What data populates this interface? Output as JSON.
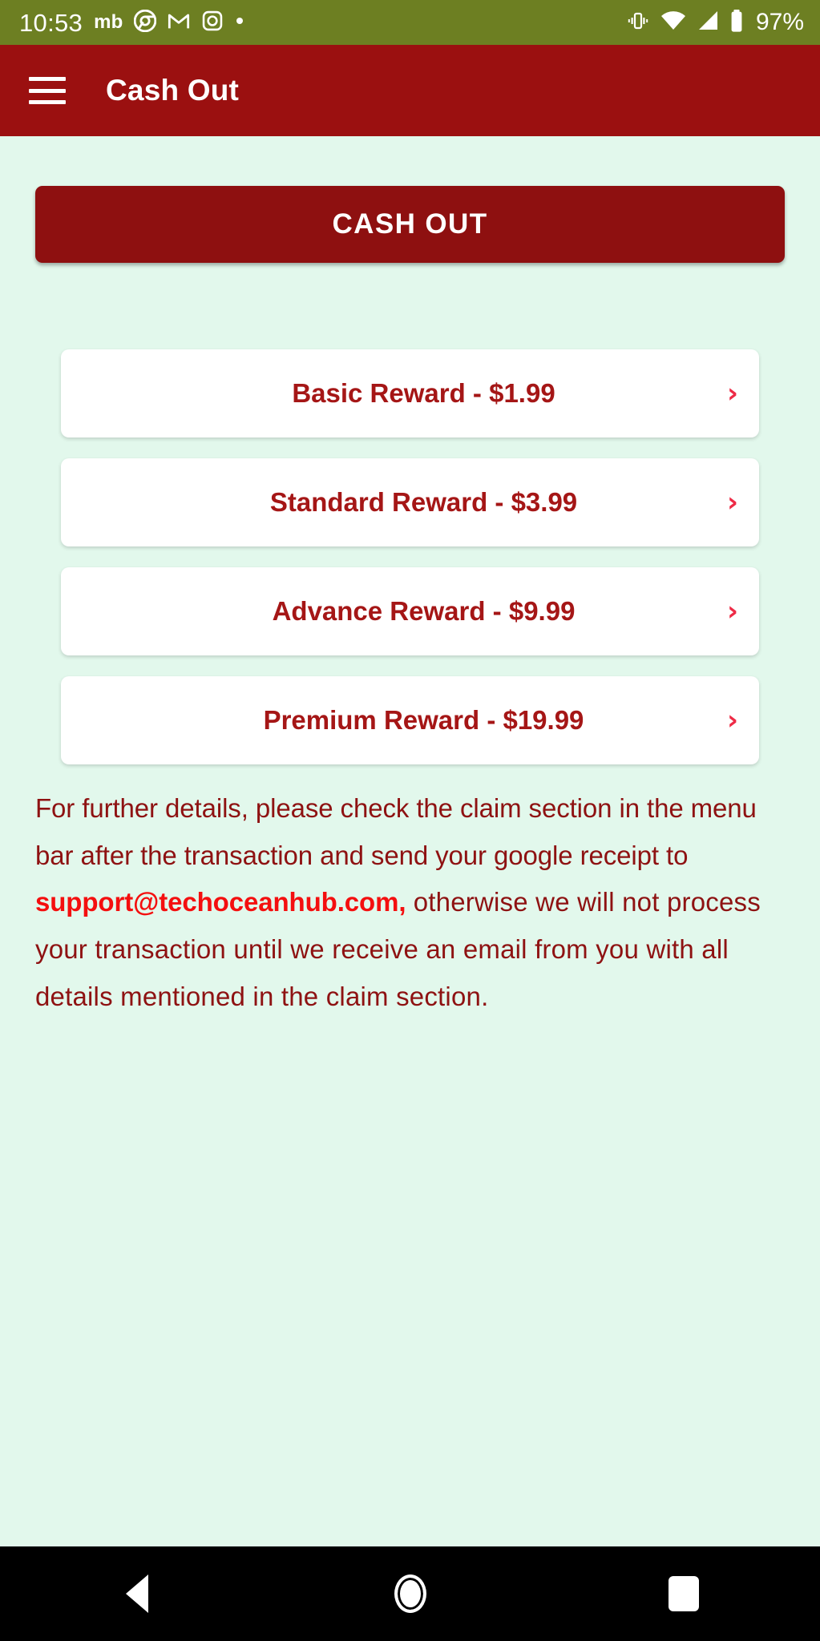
{
  "status_bar": {
    "time": "10:53",
    "mb_label": "mb",
    "battery_percent": "97%",
    "left_icons": [
      "chrome-icon",
      "gmail-icon",
      "instagram-icon",
      "dot-icon"
    ],
    "right_icons": [
      "vibrate-icon",
      "wifi-icon",
      "cellular-signal-icon",
      "battery-icon"
    ],
    "background_color": "#6D7F22"
  },
  "app_bar": {
    "menu_icon": "hamburger-menu-icon",
    "title": "Cash Out",
    "background_color": "#9B1010"
  },
  "main": {
    "background_color": "#E2F8EC",
    "cash_out_button": {
      "label": "CASH OUT",
      "background_color": "#8E1010",
      "text_color": "#FFFFFF"
    },
    "rewards": [
      {
        "label": "Basic Reward - $1.99",
        "price": "$1.99",
        "tier": "Basic",
        "chevron": "chevron-right-icon"
      },
      {
        "label": "Standard Reward - $3.99",
        "price": "$3.99",
        "tier": "Standard",
        "chevron": "chevron-right-icon"
      },
      {
        "label": "Advance Reward - $9.99",
        "price": "$9.99",
        "tier": "Advance",
        "chevron": "chevron-right-icon"
      },
      {
        "label": "Premium Reward - $19.99",
        "price": "$19.99",
        "tier": "Premium",
        "chevron": "chevron-right-icon"
      }
    ],
    "reward_text_color": "#A51616",
    "chevron_color": "#EE2B46",
    "note": {
      "part1": "For further details, please check the claim section in the menu bar after the transaction and send your google receipt to ",
      "email": "support@techoceanhub.com,",
      "part2": "  otherwise we will not process your transaction until we receive an email from you with all details mentioned in the claim section.",
      "text_color": "#8E1212",
      "email_color": "#F40F0F"
    }
  },
  "nav_bar": {
    "background_color": "#000000",
    "buttons": [
      {
        "name": "back-button",
        "icon": "triangle-back-icon"
      },
      {
        "name": "home-button",
        "icon": "circle-home-icon"
      },
      {
        "name": "recents-button",
        "icon": "square-recents-icon"
      }
    ]
  }
}
